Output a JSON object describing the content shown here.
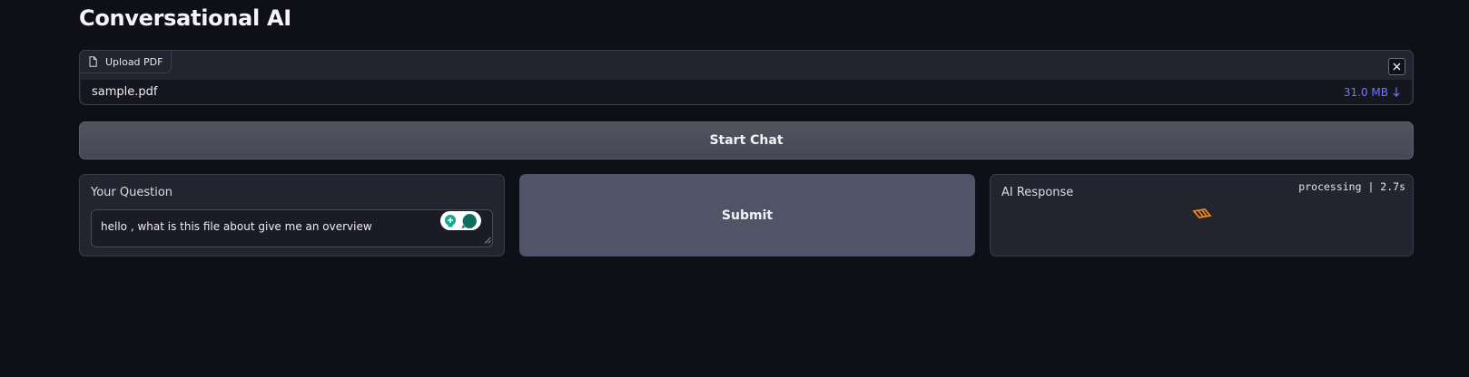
{
  "app": {
    "title": "Conversational AI"
  },
  "file_upload": {
    "label": "Upload PDF",
    "label_icon": "file-icon",
    "close_icon": "close-icon",
    "file_name": "sample.pdf",
    "file_size": "31.0 MB",
    "download_icon": "download-arrow-icon",
    "accent_color": "#6b7cf5"
  },
  "start_chat": {
    "label": "Start Chat"
  },
  "question": {
    "label": "Your Question",
    "value": "hello , what is this file about give me an overview",
    "widget_icon": "grammar-assistant-icon"
  },
  "submit": {
    "label": "Submit"
  },
  "response": {
    "label": "AI Response",
    "status": "processing | 2.7s",
    "loader_icon": "loading-spinner-icon",
    "loader_color": "#e8861f"
  }
}
